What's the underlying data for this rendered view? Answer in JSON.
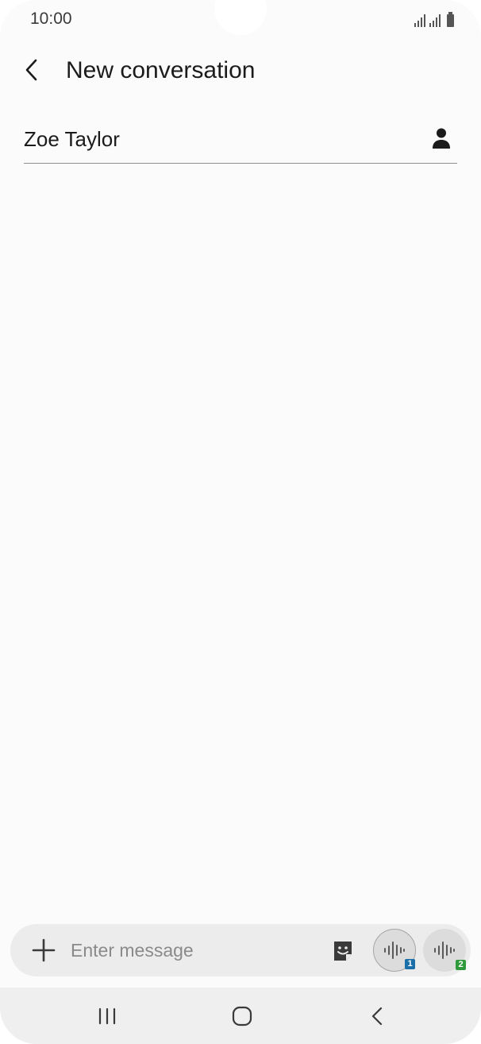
{
  "status_bar": {
    "time": "10:00",
    "icons": [
      "signal-sim1-icon",
      "signal-sim2-icon",
      "battery-icon"
    ]
  },
  "header": {
    "back_icon": "chevron-left-icon",
    "title": "New conversation"
  },
  "recipient": {
    "value": "Zoe Taylor",
    "contact_icon": "person-icon"
  },
  "compose": {
    "attach_icon": "plus-icon",
    "placeholder": "Enter message",
    "sticker_icon": "sticker-icon",
    "voice_sim1_badge": "1",
    "voice_sim2_badge": "2",
    "colors": {
      "sim1": "#1a6fa8",
      "sim2": "#2f9a3c"
    }
  },
  "navbar": {
    "icons": [
      "recent-apps-icon",
      "home-icon",
      "back-icon"
    ]
  }
}
